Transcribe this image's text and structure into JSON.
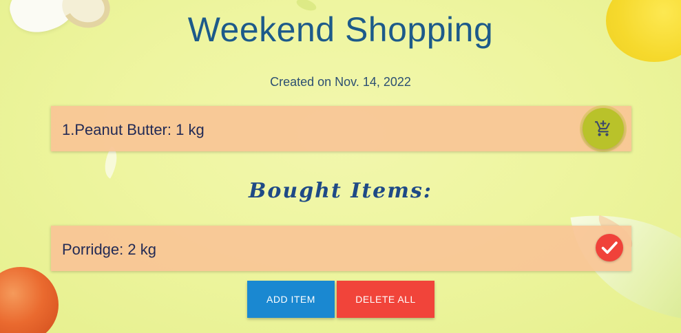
{
  "page": {
    "title": "Weekend Shopping",
    "created": "Created on Nov. 14, 2022"
  },
  "shopping_list": {
    "items": [
      {
        "label": "1.Peanut Butter: 1 kg",
        "action_icon": "add-to-cart-icon"
      }
    ]
  },
  "bought": {
    "heading": "Bought Items:",
    "items": [
      {
        "label": "Porridge: 2 kg",
        "status_icon": "check-icon"
      }
    ]
  },
  "actions": {
    "add_label": "ADD ITEM",
    "delete_label": "DELETE ALL"
  },
  "colors": {
    "title": "#1d5a8a",
    "card": "#f8c496",
    "cart_button": "#b9c22a",
    "check_button": "#f0423a",
    "add_button": "#1a88d1",
    "delete_button": "#f1443a"
  }
}
